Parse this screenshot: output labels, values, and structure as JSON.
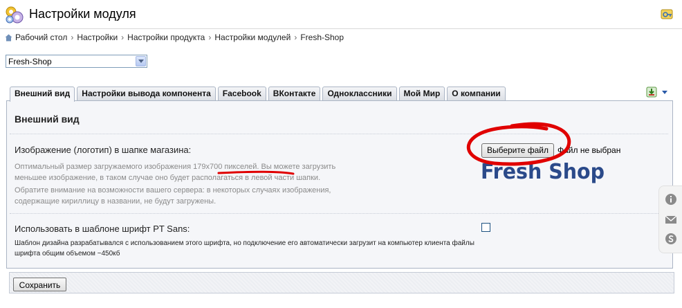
{
  "header": {
    "title": "Настройки модуля",
    "icons": {
      "module": "gears-icon",
      "help": "help-key-icon"
    }
  },
  "breadcrumb": {
    "items": [
      "Рабочий стол",
      "Настройки",
      "Настройки продукта",
      "Настройки модулей",
      "Fresh-Shop"
    ],
    "separator": "›"
  },
  "module_select": {
    "value": "Fresh-Shop"
  },
  "tabs": [
    {
      "label": "Внешний вид",
      "active": true
    },
    {
      "label": "Настройки вывода компонента",
      "active": false
    },
    {
      "label": "Facebook",
      "active": false
    },
    {
      "label": "ВКонтакте",
      "active": false
    },
    {
      "label": "Одноклассники",
      "active": false
    },
    {
      "label": "Мой Мир",
      "active": false
    },
    {
      "label": "О компании",
      "active": false
    }
  ],
  "section": {
    "title": "Внешний вид",
    "logo_option": {
      "label": "Изображение (логотип) в шапке магазина:",
      "hint_1": "Оптимальный размер загружаемого изображения 179x700 пикселей. Вы можете загрузить меньшее изображение, в таком случае оно будет располагаться в левой части шапки.",
      "hint_2": "Обратите внимание на возможности вашего сервера: в некоторых случаях изображения, содержащие кириллицу в названии, не будут загружены.",
      "file_button": "Выберите файл",
      "file_status": "Файл не выбран",
      "logo_preview": "Fresh Shop"
    },
    "font_option": {
      "label": "Использовать в шаблоне шрифт PT Sans:",
      "hint": "Шаблон дизайна разрабатывался с использованием этого шрифта, но подключение его автоматически загрузит на компьютер клиента файлы шрифта общим объемом ~450кб",
      "checked": false
    }
  },
  "footer": {
    "save_label": "Сохранить"
  },
  "side_widget": {
    "icons": [
      "info-icon",
      "mail-icon",
      "skype-icon"
    ]
  },
  "colors": {
    "annotation": "#e00000",
    "logo": "#2b4a8a",
    "panel_bg": "#f5f6f9"
  }
}
